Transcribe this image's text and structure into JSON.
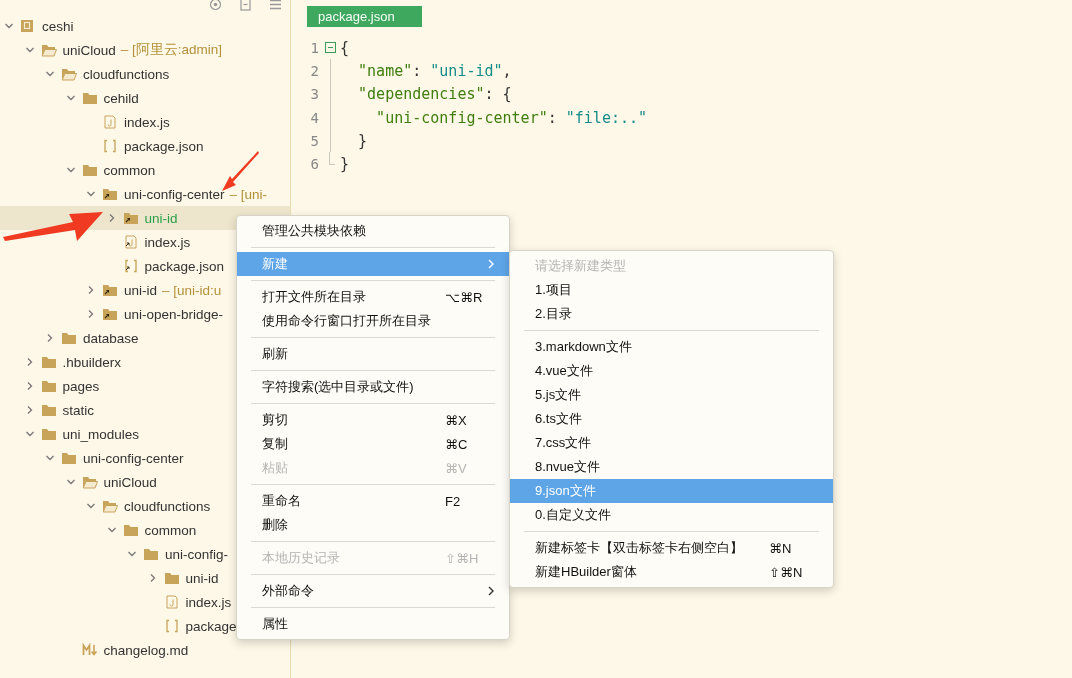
{
  "tree": [
    {
      "label": "ceshi",
      "kind": "project",
      "expanded": true,
      "selected": false,
      "children": [
        {
          "label": "uniCloud",
          "suffix": "– [阿里云:admin]",
          "kind": "cloud-folder",
          "expanded": true,
          "selected": false,
          "children": [
            {
              "label": "cloudfunctions",
              "kind": "cloud-folder",
              "expanded": true,
              "selected": false,
              "children": [
                {
                  "label": "cehild",
                  "kind": "folder",
                  "expanded": true,
                  "selected": false,
                  "children": [
                    {
                      "label": "index.js",
                      "kind": "js",
                      "selected": false
                    },
                    {
                      "label": "package.json",
                      "kind": "json",
                      "selected": false
                    }
                  ]
                },
                {
                  "label": "common",
                  "kind": "folder",
                  "expanded": true,
                  "selected": false,
                  "children": [
                    {
                      "label": "uni-config-center",
                      "suffix": "– [uni-",
                      "kind": "link-folder",
                      "expanded": true,
                      "selected": false,
                      "children": [
                        {
                          "label": "uni-id",
                          "kind": "link-folder",
                          "expanded": false,
                          "selected": true
                        },
                        {
                          "label": "index.js",
                          "kind": "link-js",
                          "selected": false
                        },
                        {
                          "label": "package.json",
                          "kind": "link-json",
                          "selected": false
                        }
                      ]
                    },
                    {
                      "label": "uni-id",
                      "suffix": "– [uni-id:u",
                      "kind": "link-folder",
                      "expanded": false,
                      "selected": false
                    },
                    {
                      "label": "uni-open-bridge-",
                      "kind": "link-folder",
                      "expanded": false,
                      "selected": false
                    }
                  ]
                }
              ]
            },
            {
              "label": "database",
              "kind": "folder",
              "expanded": false,
              "selected": false
            }
          ]
        },
        {
          "label": ".hbuilderx",
          "kind": "folder",
          "expanded": false,
          "selected": false
        },
        {
          "label": "pages",
          "kind": "folder",
          "expanded": false,
          "selected": false
        },
        {
          "label": "static",
          "kind": "folder",
          "expanded": false,
          "selected": false
        },
        {
          "label": "uni_modules",
          "kind": "folder",
          "expanded": true,
          "selected": false,
          "children": [
            {
              "label": "uni-config-center",
              "kind": "folder",
              "expanded": true,
              "selected": false,
              "children": [
                {
                  "label": "uniCloud",
                  "kind": "cloud-folder",
                  "expanded": true,
                  "selected": false,
                  "children": [
                    {
                      "label": "cloudfunctions",
                      "kind": "cloud-folder",
                      "expanded": true,
                      "selected": false,
                      "children": [
                        {
                          "label": "common",
                          "kind": "folder",
                          "expanded": true,
                          "selected": false,
                          "children": [
                            {
                              "label": "uni-config-",
                              "kind": "folder",
                              "expanded": true,
                              "selected": false,
                              "children": [
                                {
                                  "label": "uni-id",
                                  "kind": "folder",
                                  "expanded": false,
                                  "selected": false
                                },
                                {
                                  "label": "index.js",
                                  "kind": "js",
                                  "selected": false
                                },
                                {
                                  "label": "package",
                                  "kind": "json",
                                  "selected": false
                                }
                              ]
                            }
                          ]
                        }
                      ]
                    }
                  ]
                },
                {
                  "label": "changelog.md",
                  "kind": "md",
                  "selected": false
                }
              ]
            }
          ]
        }
      ]
    }
  ],
  "editor": {
    "tab": {
      "label": "package.json",
      "selected": true
    },
    "lines": [
      {
        "number": "1",
        "kind": "fold-start",
        "tokens": [
          {
            "kind": "punct",
            "text": "{"
          }
        ]
      },
      {
        "number": "2",
        "kind": "plain",
        "tokens": [
          {
            "kind": "key",
            "text": "  \"name\""
          },
          {
            "kind": "punct",
            "text": ": "
          },
          {
            "kind": "string",
            "text": "\"uni-id\""
          },
          {
            "kind": "punct",
            "text": ","
          }
        ]
      },
      {
        "number": "3",
        "kind": "plain",
        "tokens": [
          {
            "kind": "key",
            "text": "  \"dependencies\""
          },
          {
            "kind": "punct",
            "text": ": {"
          }
        ]
      },
      {
        "number": "4",
        "kind": "plain",
        "tokens": [
          {
            "kind": "key",
            "text": "    \"uni-config-center\""
          },
          {
            "kind": "punct",
            "text": ": "
          },
          {
            "kind": "string",
            "text": "\"file:..\""
          }
        ]
      },
      {
        "number": "5",
        "kind": "plain",
        "tokens": [
          {
            "kind": "punct",
            "text": "  }"
          }
        ]
      },
      {
        "number": "6",
        "kind": "fold-end",
        "tokens": [
          {
            "kind": "punct",
            "text": "}"
          }
        ]
      }
    ]
  },
  "context_menu": {
    "items": [
      {
        "kind": "item",
        "label": "管理公共模块依赖",
        "selected": false,
        "disabled": false
      },
      {
        "kind": "separator"
      },
      {
        "kind": "item",
        "label": "新建",
        "submenu": true,
        "selected": true,
        "disabled": false
      },
      {
        "kind": "separator"
      },
      {
        "kind": "item",
        "label": "打开文件所在目录",
        "shortcut": "⌥⌘R",
        "selected": false,
        "disabled": false
      },
      {
        "kind": "item",
        "label": "使用命令行窗口打开所在目录",
        "selected": false,
        "disabled": false
      },
      {
        "kind": "separator"
      },
      {
        "kind": "item",
        "label": "刷新",
        "selected": false,
        "disabled": false
      },
      {
        "kind": "separator"
      },
      {
        "kind": "item",
        "label": "字符搜索(选中目录或文件)",
        "selected": false,
        "disabled": false
      },
      {
        "kind": "separator"
      },
      {
        "kind": "item",
        "label": "剪切",
        "shortcut": "⌘X",
        "selected": false,
        "disabled": false
      },
      {
        "kind": "item",
        "label": "复制",
        "shortcut": "⌘C",
        "selected": false,
        "disabled": false
      },
      {
        "kind": "item",
        "label": "粘贴",
        "shortcut": "⌘V",
        "selected": false,
        "disabled": true
      },
      {
        "kind": "separator"
      },
      {
        "kind": "item",
        "label": "重命名",
        "shortcut": "F2",
        "selected": false,
        "disabled": false
      },
      {
        "kind": "item",
        "label": "删除",
        "selected": false,
        "disabled": false
      },
      {
        "kind": "separator"
      },
      {
        "kind": "item",
        "label": "本地历史记录",
        "shortcut": "⇧⌘H",
        "selected": false,
        "disabled": true
      },
      {
        "kind": "separator"
      },
      {
        "kind": "item",
        "label": "外部命令",
        "submenu": true,
        "selected": false,
        "disabled": false
      },
      {
        "kind": "separator"
      },
      {
        "kind": "item",
        "label": "属性",
        "selected": false,
        "disabled": false
      }
    ]
  },
  "submenu": {
    "items": [
      {
        "kind": "item",
        "label": "请选择新建类型",
        "selected": false,
        "disabled": true
      },
      {
        "kind": "item",
        "label": "1.项目",
        "selected": false,
        "disabled": false
      },
      {
        "kind": "item",
        "label": "2.目录",
        "selected": false,
        "disabled": false
      },
      {
        "kind": "separator"
      },
      {
        "kind": "item",
        "label": "3.markdown文件",
        "selected": false,
        "disabled": false
      },
      {
        "kind": "item",
        "label": "4.vue文件",
        "selected": false,
        "disabled": false
      },
      {
        "kind": "item",
        "label": "5.js文件",
        "selected": false,
        "disabled": false
      },
      {
        "kind": "item",
        "label": "6.ts文件",
        "selected": false,
        "disabled": false
      },
      {
        "kind": "item",
        "label": "7.css文件",
        "selected": false,
        "disabled": false
      },
      {
        "kind": "item",
        "label": "8.nvue文件",
        "selected": false,
        "disabled": false
      },
      {
        "kind": "item",
        "label": "9.json文件",
        "selected": true,
        "disabled": false
      },
      {
        "kind": "item",
        "label": "0.自定义文件",
        "selected": false,
        "disabled": false
      },
      {
        "kind": "separator"
      },
      {
        "kind": "item",
        "label": "新建标签卡【双击标签卡右侧空白】",
        "shortcut": "⌘N",
        "selected": false,
        "disabled": false
      },
      {
        "kind": "item",
        "label": "新建HBuilder窗体",
        "shortcut": "⇧⌘N",
        "selected": false,
        "disabled": false
      }
    ]
  }
}
